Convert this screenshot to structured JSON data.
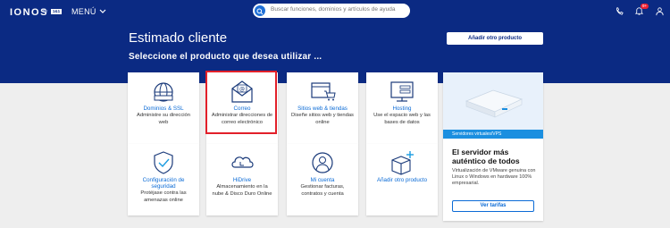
{
  "header": {
    "logo": "IONOS",
    "logo_sub": "by",
    "logo_badge": "1&1",
    "menu_label": "MENÚ",
    "search_placeholder": "Buscar funciones, dominios y artículos de ayuda",
    "notification_count": "9+"
  },
  "page": {
    "title": "Estimado cliente",
    "subtitle": "Seleccione el producto que desea utilizar ...",
    "add_product_button": "Añadir otro producto"
  },
  "products": [
    {
      "title": "Dominios & SSL",
      "desc": "Administre su dirección web"
    },
    {
      "title": "Correo",
      "desc": "Administrar direcciones de correo electrónico"
    },
    {
      "title": "Sitios web & tiendas",
      "desc": "Diseñe sitios web y tiendas online"
    },
    {
      "title": "Hosting",
      "desc": "Use el espacio web y las bases de datos"
    },
    {
      "title": "Configuración de seguridad",
      "desc": "Protéjase contra las amenazas online"
    },
    {
      "title": "HiDrive",
      "desc": "Almacenamiento en la nube & Disco Duro Online"
    },
    {
      "title": "Mi cuenta",
      "desc": "Gestionar facturas, contratos y cuenta"
    },
    {
      "title": "Añadir otro producto",
      "desc": ""
    }
  ],
  "vps": {
    "bar_label": "Servidores virtuales/VPS",
    "title": "El servidor más auténtico de todos",
    "desc": "Virtualización de VMware genuina con Linux o Windows en hardware 100% empresarial.",
    "button": "Ver tarifas"
  },
  "colors": {
    "brand": "#0b2a83",
    "link": "#0b6bd6",
    "highlight": "#e2202a"
  }
}
